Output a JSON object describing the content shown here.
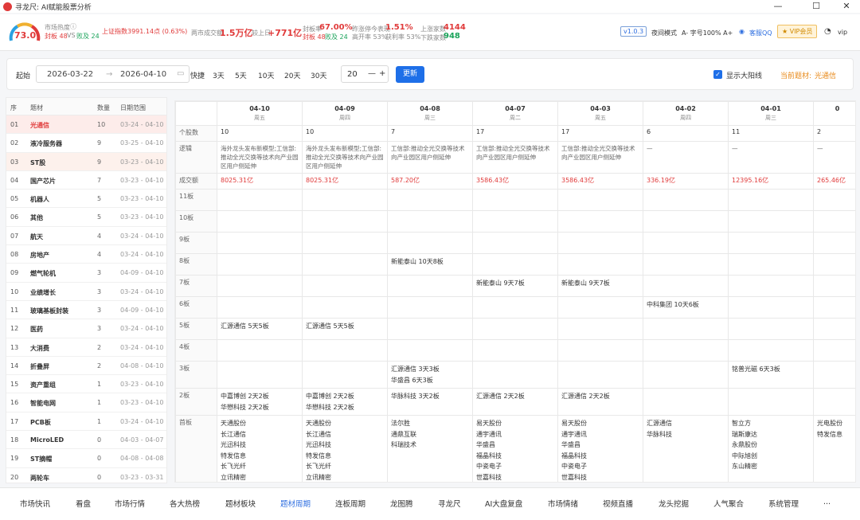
{
  "title": "寻龙尺: AI赋能股票分析",
  "window_controls": [
    "—",
    "☐",
    "✕"
  ],
  "header": {
    "gauge_value": "73.0",
    "heat_label": "市场热度",
    "fengban": "封板 48",
    "vs": "VS",
    "poban": "败及 24",
    "index": "上证指数3991.14点 (0.63%)",
    "turnover_label": "两市成交额",
    "turnover": "1.5万亿",
    "change_label": "较上日",
    "change": "+771亿",
    "seal_rate_label": "封板率",
    "seal_rate": "67.00%",
    "seal_sub": "封板 48",
    "seal_sub2": "败及 24",
    "yest_label": "昨涨停今表现",
    "yest_val": "1.51%",
    "high_open": "高开率 53%",
    "profit": "获利率 53%",
    "up_label": "上涨家数",
    "up_val": "4144",
    "down_label": "下跌家数",
    "down_val": "948",
    "version": "v1.0.3",
    "night": "夜间模式",
    "font_ctl": "A-  字号100%  A+",
    "service": "客服QQ",
    "vip": "★ VIP会员",
    "user": "vip"
  },
  "toolbar": {
    "start_label": "起始",
    "start_date": "2026-03-22",
    "arrow": "→",
    "end_date": "2026-04-10",
    "quick_label": "快捷",
    "quick": [
      "3天",
      "5天",
      "10天",
      "20天",
      "30天"
    ],
    "count": "20",
    "minus": "—",
    "plus": "+",
    "update": "更新",
    "show_big": "显示大阳线",
    "current_label": "当前题材:",
    "current_val": "光通信"
  },
  "left": {
    "headers": [
      "序",
      "题材",
      "数量",
      "日期范围"
    ],
    "rows": [
      [
        "01",
        "光通信",
        "10",
        "03-24 - 04-10"
      ],
      [
        "02",
        "液冷服务器",
        "9",
        "03-25 - 04-10"
      ],
      [
        "03",
        "ST股",
        "9",
        "03-23 - 04-10"
      ],
      [
        "04",
        "国产芯片",
        "7",
        "03-23 - 04-10"
      ],
      [
        "05",
        "机器人",
        "5",
        "03-23 - 04-10"
      ],
      [
        "06",
        "其他",
        "5",
        "03-23 - 04-10"
      ],
      [
        "07",
        "航天",
        "4",
        "03-24 - 04-10"
      ],
      [
        "08",
        "房地产",
        "4",
        "03-24 - 04-10"
      ],
      [
        "09",
        "燃气轮机",
        "3",
        "04-09 - 04-10"
      ],
      [
        "10",
        "业绩增长",
        "3",
        "03-24 - 04-10"
      ],
      [
        "11",
        "玻璃基板封装",
        "3",
        "04-09 - 04-10"
      ],
      [
        "12",
        "医药",
        "3",
        "03-24 - 04-10"
      ],
      [
        "13",
        "大消费",
        "2",
        "03-24 - 04-10"
      ],
      [
        "14",
        "折叠屏",
        "2",
        "04-08 - 04-10"
      ],
      [
        "15",
        "资产重组",
        "1",
        "03-23 - 04-10"
      ],
      [
        "16",
        "智能电网",
        "1",
        "03-23 - 04-10"
      ],
      [
        "17",
        "PCB板",
        "1",
        "03-24 - 04-10"
      ],
      [
        "18",
        "MicroLED",
        "0",
        "04-03 - 04-07"
      ],
      [
        "19",
        "ST摘帽",
        "0",
        "04-08 - 04-08"
      ],
      [
        "20",
        "两轮车",
        "0",
        "03-23 - 03-31"
      ]
    ]
  },
  "grid": {
    "dates": [
      {
        "d": "04-10",
        "w": "周五"
      },
      {
        "d": "04-09",
        "w": "周四"
      },
      {
        "d": "04-08",
        "w": "周三"
      },
      {
        "d": "04-07",
        "w": "周二"
      },
      {
        "d": "04-03",
        "w": "周五"
      },
      {
        "d": "04-02",
        "w": "周四"
      },
      {
        "d": "04-01",
        "w": "周三"
      },
      {
        "d": "0",
        "w": ""
      }
    ],
    "row_labels": {
      "count": "个股数",
      "logic": "逻辑",
      "amount": "成交额"
    },
    "counts": [
      "10",
      "10",
      "7",
      "17",
      "17",
      "6",
      "11",
      "2"
    ],
    "logic": [
      "海外龙头发布新模型;工信部:推动全光交换等技术向产业园区用户侧延伸",
      "海外龙头发布新模型;工信部:推动全光交换等技术向产业园区用户侧延伸",
      "工信部:推动全光交换等技术向产业园区用户侧延伸",
      "工信部:推动全光交换等技术向产业园区用户侧延伸",
      "工信部:推动全光交换等技术向产业园区用户侧延伸",
      "—",
      "—",
      "—"
    ],
    "amounts": [
      "8025.31亿",
      "8025.31亿",
      "587.20亿",
      "3586.43亿",
      "3586.43亿",
      "336.19亿",
      "12395.16亿",
      "265.46亿"
    ],
    "levels": [
      {
        "label": "11板",
        "cells": [
          [],
          [],
          [],
          [],
          [],
          [],
          [],
          []
        ]
      },
      {
        "label": "10板",
        "cells": [
          [],
          [],
          [],
          [],
          [],
          [],
          [],
          []
        ]
      },
      {
        "label": "9板",
        "cells": [
          [],
          [],
          [],
          [],
          [],
          [],
          [],
          []
        ]
      },
      {
        "label": "8板",
        "cells": [
          [],
          [],
          [
            "新能泰山 10天8板"
          ],
          [],
          [],
          [],
          [],
          []
        ]
      },
      {
        "label": "7板",
        "cells": [
          [],
          [],
          [],
          [
            "新能泰山 9天7板"
          ],
          [
            "新能泰山 9天7板"
          ],
          [],
          [],
          []
        ]
      },
      {
        "label": "6板",
        "cells": [
          [],
          [],
          [],
          [],
          [],
          [
            "中科集团 10天6板"
          ],
          [],
          []
        ]
      },
      {
        "label": "5板",
        "cells": [
          [
            "汇源通信 5天5板"
          ],
          [
            "汇源通信 5天5板"
          ],
          [],
          [],
          [],
          [],
          [],
          []
        ]
      },
      {
        "label": "4板",
        "cells": [
          [],
          [],
          [],
          [],
          [],
          [],
          [],
          []
        ]
      },
      {
        "label": "3板",
        "cells": [
          [],
          [],
          [
            "汇源通信 3天3板",
            "华盛昌 6天3板"
          ],
          [],
          [],
          [],
          [
            "铭普光磁 6天3板"
          ],
          []
        ]
      },
      {
        "label": "2板",
        "cells": [
          [
            "中嘉博创 2天2板",
            "华懋科技 2天2板"
          ],
          [
            "中嘉博创 2天2板",
            "华懋科技 2天2板"
          ],
          [
            "华脉科技 3天2板"
          ],
          [
            "汇源通信 2天2板"
          ],
          [
            "汇源通信 2天2板"
          ],
          [],
          [],
          []
        ]
      },
      {
        "label": "首板",
        "cells": [
          [
            "天通股份",
            "长江通信",
            "光迅科技",
            "特发信息",
            "长飞光纤",
            "立讯精密"
          ],
          [
            "天通股份",
            "长江通信",
            "光迅科技",
            "特发信息",
            "长飞光纤",
            "立讯精密"
          ],
          [
            "法尔胜",
            "通鼎互联",
            "科瑞技术"
          ],
          [
            "易天股份",
            "通宇通讯",
            "华盛昌",
            "福晶科技",
            "中瓷电子",
            "世嘉科技"
          ],
          [
            "易天股份",
            "通宇通讯",
            "华盛昌",
            "福晶科技",
            "中瓷电子",
            "世嘉科技"
          ],
          [
            "汇源通信",
            "华脉科技"
          ],
          [
            "智立方",
            "瑞斯康达",
            "永鼎股份",
            "中际旭创",
            "东山精密"
          ],
          [
            "光电股份",
            "特发信息"
          ]
        ]
      }
    ]
  },
  "nav": [
    "市场快讯",
    "看盘",
    "市场行情",
    "各大热榜",
    "题材板块",
    "题材周期",
    "连板周期",
    "龙图腾",
    "寻龙尺",
    "AI大盘复盘",
    "市场情绪",
    "视频直播",
    "龙头挖掘",
    "人气聚合",
    "系统管理",
    "..."
  ],
  "nav_active": 5
}
